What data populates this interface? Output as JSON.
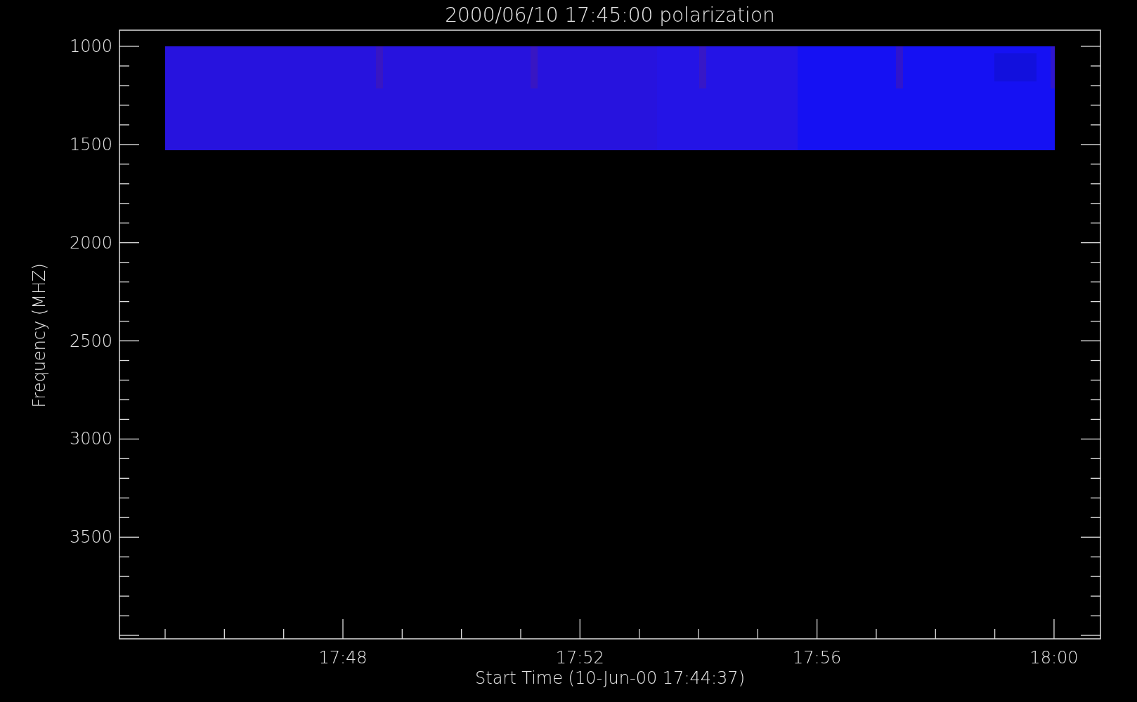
{
  "title": "2000/06/10 17:45:00 polarization",
  "y_axis": {
    "label": "Frequency (MHZ)",
    "ticks": [
      "1000",
      "1500",
      "2000",
      "2500",
      "3000",
      "3500"
    ]
  },
  "x_axis": {
    "label": "Start Time (10-Jun-00 17:44:37)",
    "ticks": [
      "17:48",
      "17:52",
      "17:56",
      "18:00"
    ]
  }
}
